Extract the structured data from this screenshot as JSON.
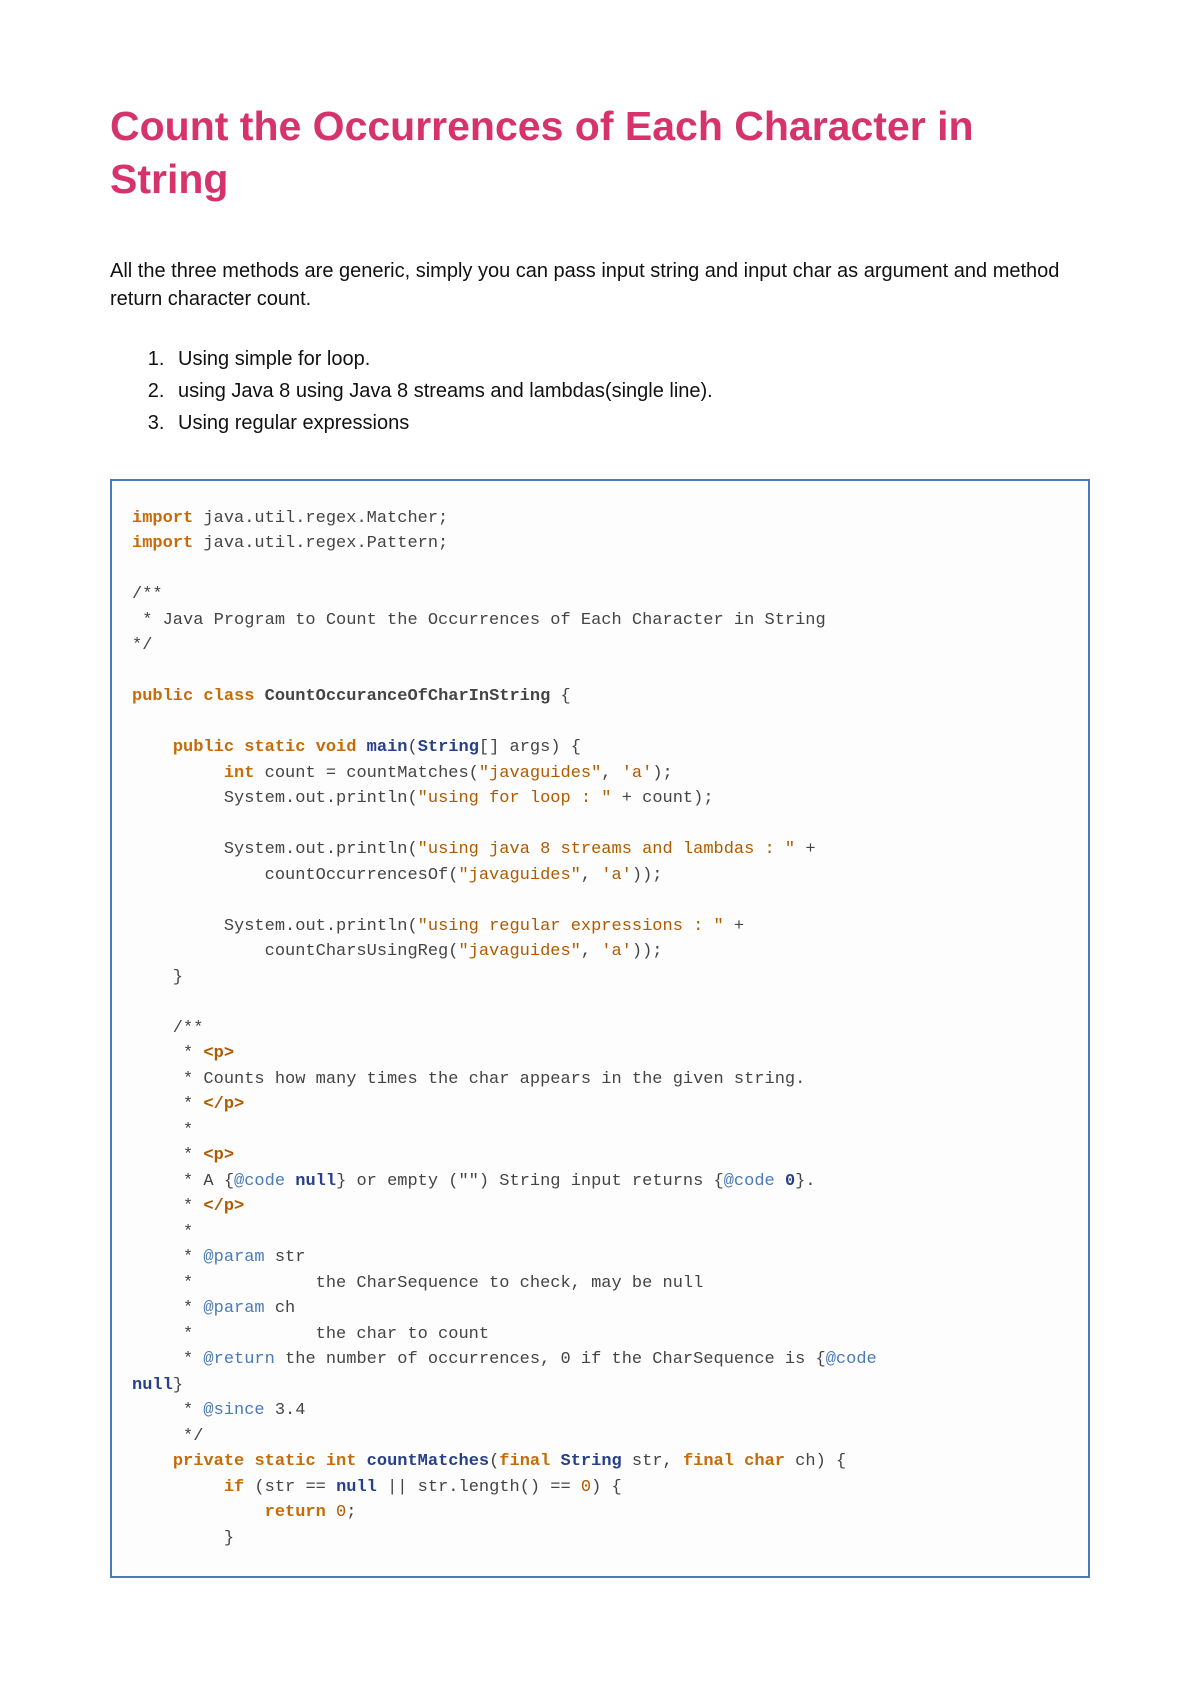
{
  "title": "Count the Occurrences of Each Character in String",
  "intro": "All the three methods are generic, simply you can pass input string and input char as argument and method return character count.",
  "methods": [
    "Using simple for loop.",
    "using Java 8 using Java 8 streams and lambdas(single line).",
    "Using regular expressions"
  ],
  "code": {
    "import1_kw": "import",
    "import1_rest": " java.util.regex.Matcher;",
    "import2_kw": "import",
    "import2_rest": " java.util.regex.Pattern;",
    "doc_open": "/**",
    "doc_line": " * Java Program to Count the Occurrences of Each Character in String",
    "doc_close": "*/",
    "public": "public",
    "class": "class",
    "classname": "CountOccuranceOfCharInString",
    "lbrace": " {",
    "static": "static",
    "void": "void",
    "main": "main",
    "String": "String",
    "args": "[] args) {",
    "int": "int",
    "count_assign": " count = countMatches(",
    "s_javaguides": "\"javaguides\"",
    "comma_sp": ", ",
    "c_a": "'a'",
    "rparen_semi": ");",
    "sysout": "System.out.println(",
    "s_forloop": "\"using for loop : \"",
    "plus_count": " + count);",
    "s_streams": "\"using java 8 streams and lambdas : \"",
    "plus": " +",
    "indent_call1": "             countOccurrencesOf(",
    "rr_semi": "));",
    "s_regex": "\"using regular expressions : \"",
    "indent_call2": "             countCharsUsingReg(",
    "rbrace": "    }",
    "jdoc_open": "    /**",
    "jdoc_star": "     * ",
    "jdoc_p_open": "<p>",
    "jdoc_counts": "     * Counts how many times the char appears in the given string.",
    "jdoc_p_close": "</p>",
    "jdoc_star_only": "     *",
    "jdoc_A": "     * A {",
    "at_code": "@code",
    "null_txt": " null",
    "jdoc_or_empty": "} or empty (\"\") String input returns {",
    "zero_txt": " 0",
    "rbrace_dot": "}.",
    "at_param": "@param",
    "param_str": " str",
    "param_str_desc": "     *            the CharSequence to check, may be null",
    "param_ch": " ch",
    "param_ch_desc": "     *            the char to count",
    "at_return": "@return",
    "return_desc_pre": " the number of occurrences, 0 if the CharSequence is {",
    "null_close": "null",
    "rbrace_only": "}",
    "at_since": "@since",
    "since_val": " 3.4",
    "jdoc_end": "     */",
    "private": "private",
    "countMatches": "countMatches",
    "final": "final",
    "str_param": " str, ",
    "char_kw": "char",
    "ch_param": " ch) {",
    "if": "if",
    "if_cond_open": " (str == ",
    "null_kw": "null",
    "or_len": " || str.length() == ",
    "zero": "0",
    "if_cond_close": ") {",
    "return": "return",
    "sp_zero_semi": " 0",
    "semi": ";",
    "close_inner": "         }"
  }
}
